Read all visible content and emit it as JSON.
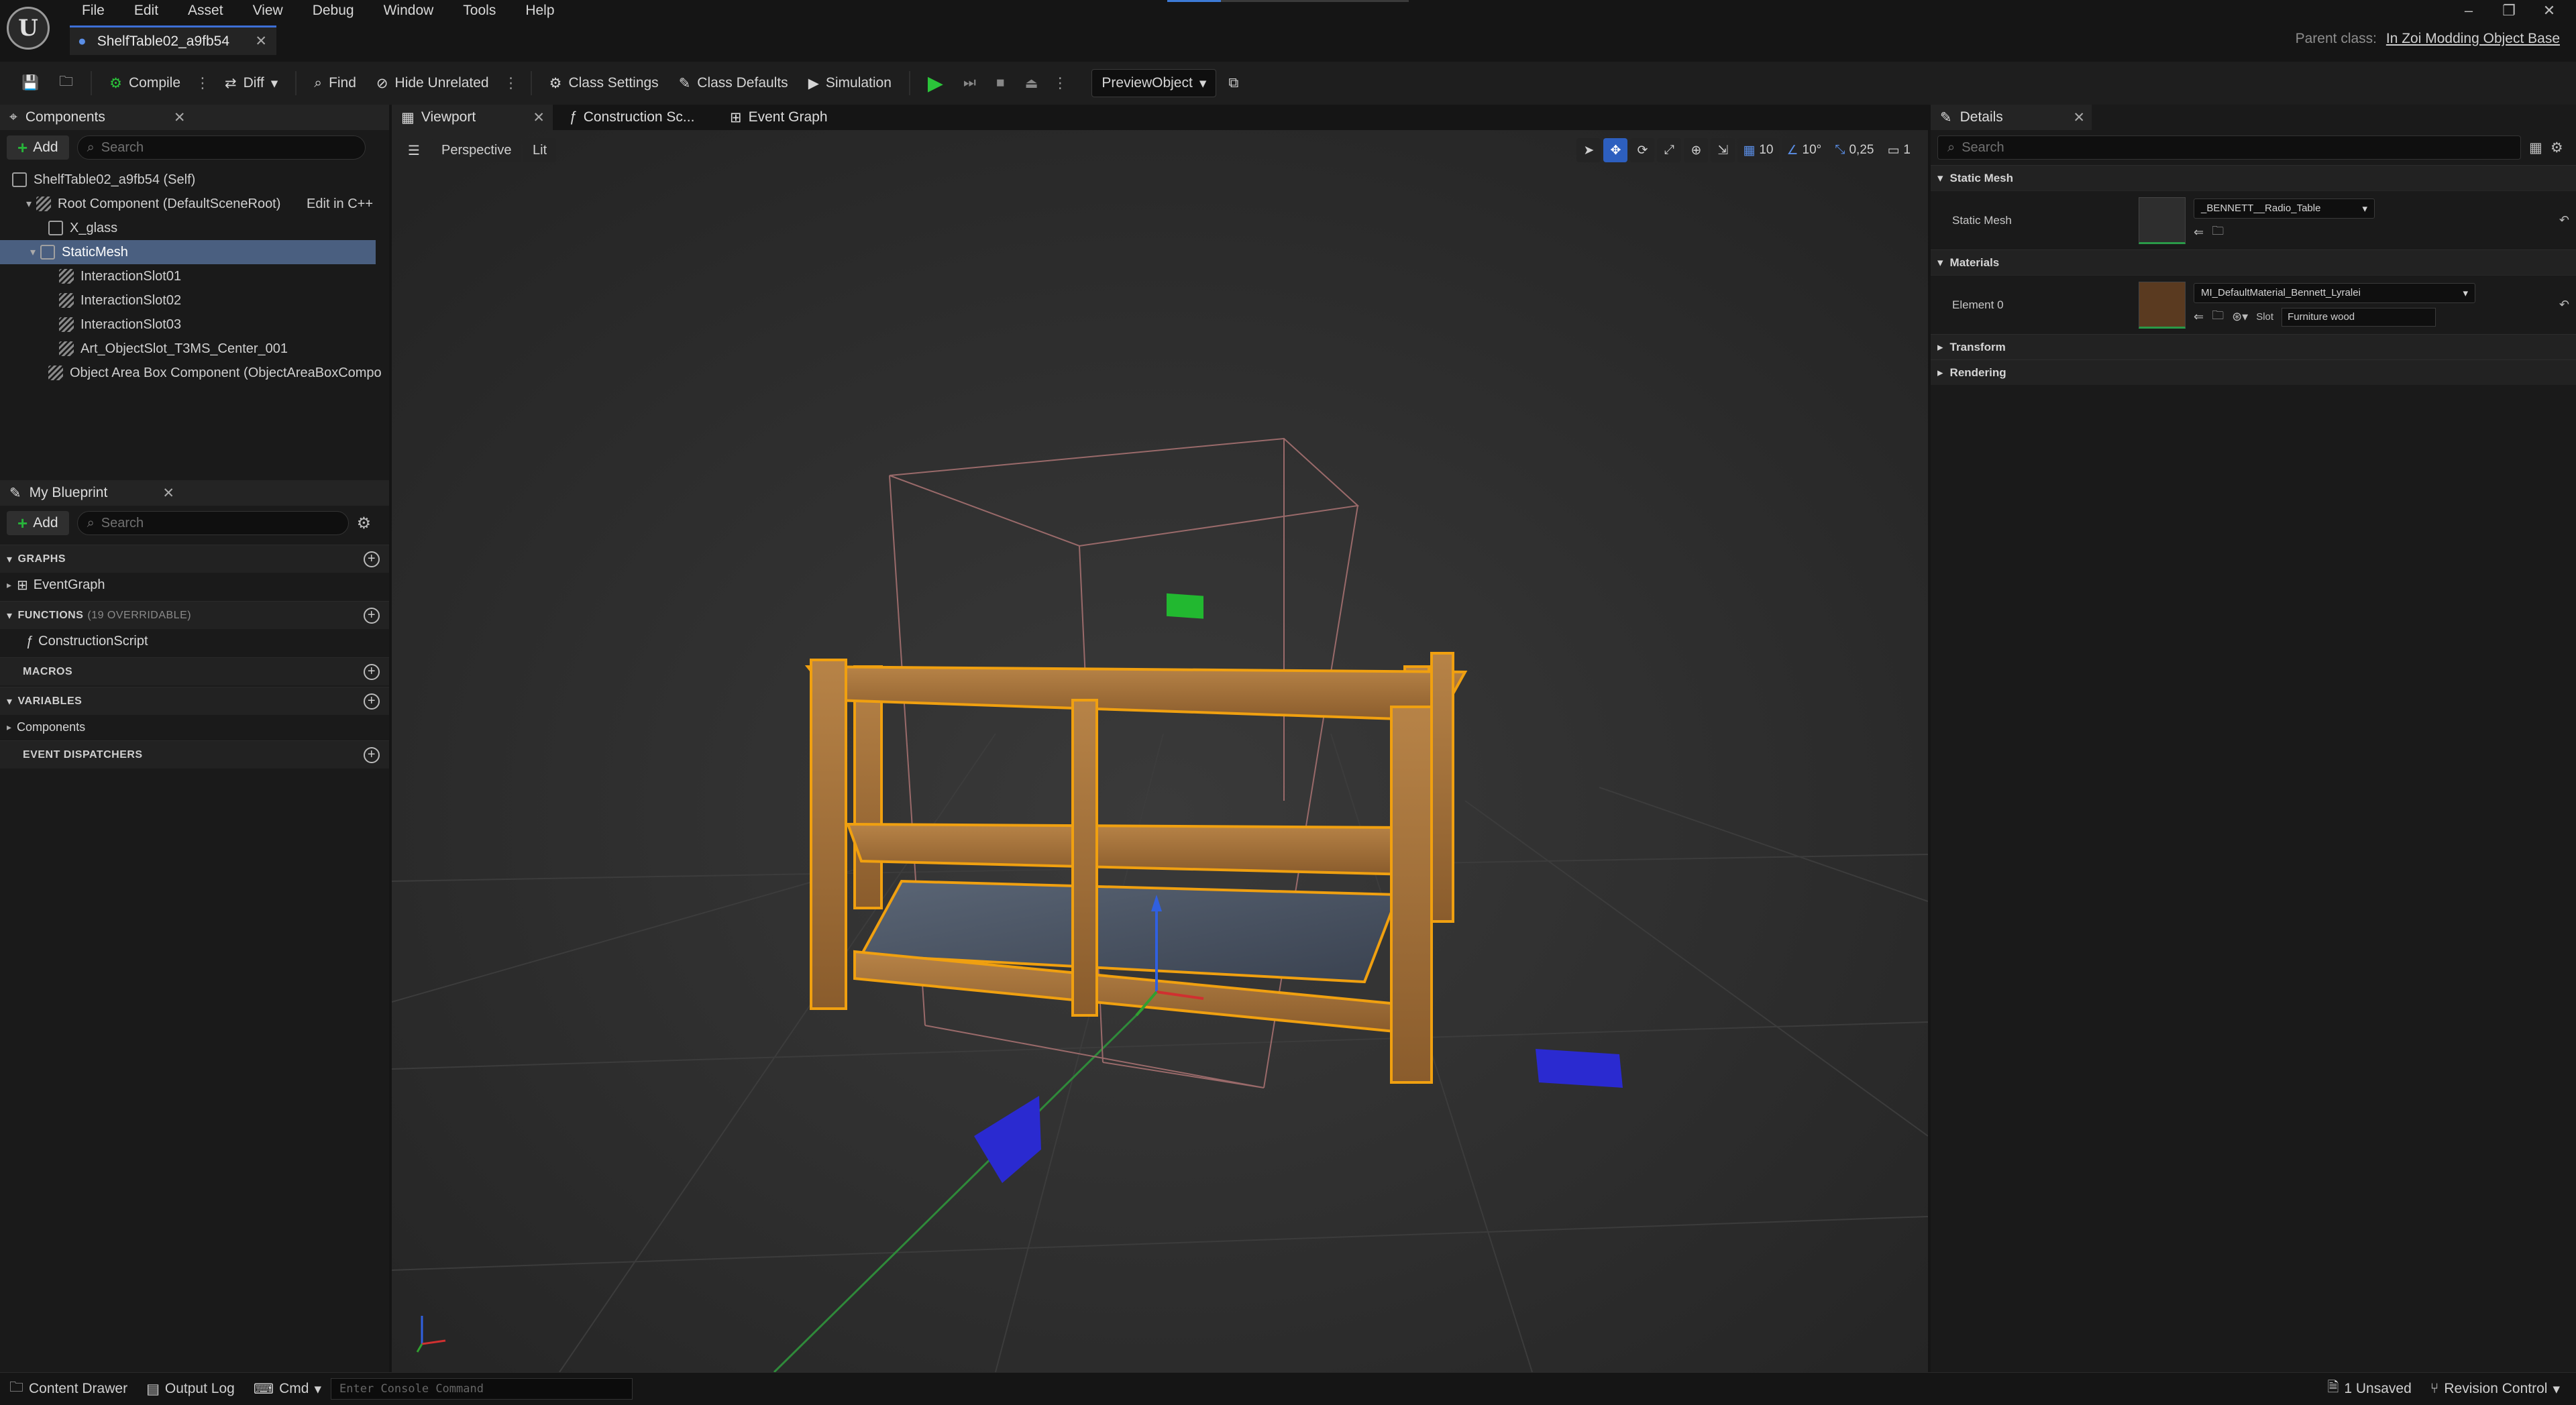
{
  "app": {
    "logo_text": "U",
    "menu": [
      "File",
      "Edit",
      "Asset",
      "View",
      "Debug",
      "Window",
      "Tools",
      "Help"
    ],
    "document_tab": "ShelfTable02_a9fb54",
    "parent_class_label": "Parent class:",
    "parent_class_value": "In Zoi Modding Object Base"
  },
  "toolbar": {
    "compile": "Compile",
    "diff": "Diff",
    "find": "Find",
    "hide_unrelated": "Hide Unrelated",
    "class_settings": "Class Settings",
    "class_defaults": "Class Defaults",
    "simulation": "Simulation",
    "preview_object": "PreviewObject"
  },
  "components_panel": {
    "title": "Components",
    "add_label": "Add",
    "search_placeholder": "Search",
    "tree": [
      {
        "label": "ShelfTable02_a9fb54 (Self)",
        "indent": 0
      },
      {
        "label": "Root Component (DefaultSceneRoot)",
        "indent": 1,
        "action": "Edit in C++"
      },
      {
        "label": "X_glass",
        "indent": 2
      },
      {
        "label": "StaticMesh",
        "indent": 2,
        "selected": true
      },
      {
        "label": "InteractionSlot01",
        "indent": 3
      },
      {
        "label": "InteractionSlot02",
        "indent": 3
      },
      {
        "label": "InteractionSlot03",
        "indent": 3
      },
      {
        "label": "Art_ObjectSlot_T3MS_Center_001",
        "indent": 3
      },
      {
        "label": "Object Area Box Component (ObjectAreaBoxCompon",
        "indent": 2
      }
    ]
  },
  "my_blueprint": {
    "title": "My Blueprint",
    "add_label": "Add",
    "search_placeholder": "Search",
    "graphs_header": "GRAPHS",
    "graphs_item": "EventGraph",
    "functions_header": "FUNCTIONS",
    "functions_sub": "(19 OVERRIDABLE)",
    "functions_item": "ConstructionScript",
    "macros_header": "MACROS",
    "variables_header": "VARIABLES",
    "variables_item": "Components",
    "dispatchers_header": "EVENT DISPATCHERS"
  },
  "viewport": {
    "tabs": [
      "Viewport",
      "Construction Sc...",
      "Event Graph"
    ],
    "perspective": "Perspective",
    "lit": "Lit",
    "grid_snap": "10",
    "rot_snap": "10°",
    "scale_snap": "0,25",
    "camera_speed": "1"
  },
  "details": {
    "title": "Details",
    "search_placeholder": "Search",
    "sec_static_mesh": "Static Mesh",
    "static_mesh_label": "Static Mesh",
    "static_mesh_value": "_BENNETT__Radio_Table",
    "sec_materials": "Materials",
    "element_label": "Element 0",
    "material_value": "MI_DefaultMaterial_Bennett_Lyralei",
    "slot_label": "Slot",
    "slot_value": "Furniture wood",
    "sec_transform": "Transform",
    "sec_rendering": "Rendering"
  },
  "statusbar": {
    "content_drawer": "Content Drawer",
    "output_log": "Output Log",
    "cmd": "Cmd",
    "console_placeholder": "Enter Console Command",
    "unsaved": "1 Unsaved",
    "revision_control": "Revision Control"
  }
}
